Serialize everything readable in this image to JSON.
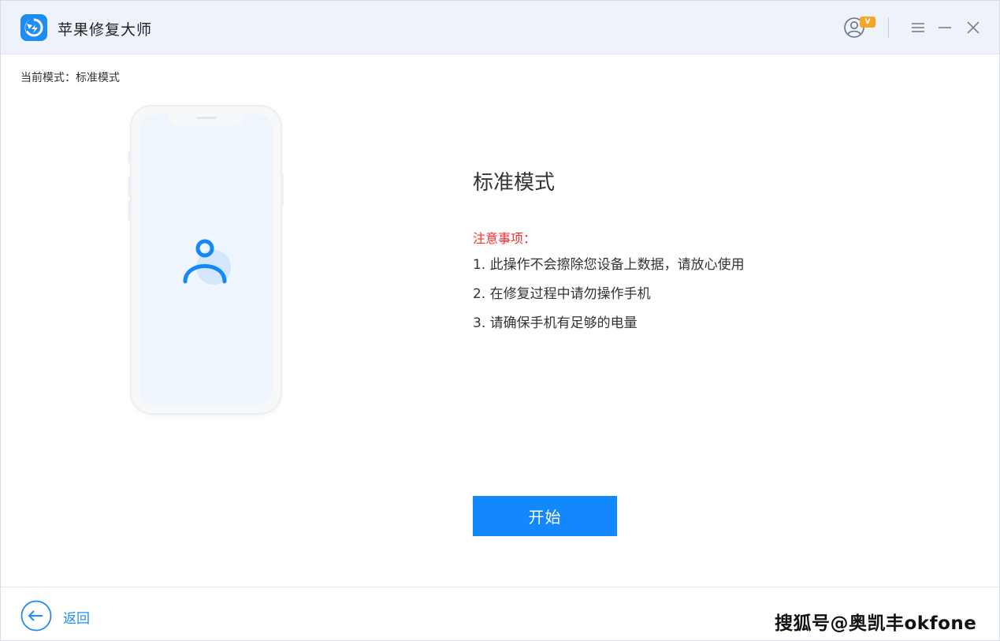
{
  "window": {
    "title": "苹果修复大师",
    "accent_color": "#1288fc",
    "vip_badge": "V"
  },
  "mode_line": {
    "label": "当前模式：标准模式"
  },
  "main": {
    "title": "标准模式",
    "notice_title": "注意事项：",
    "notices": [
      "1. 此操作不会擦除您设备上数据，请放心使用",
      "2. 在修复过程中请勿操作手机",
      "3. 请确保手机有足够的电量"
    ],
    "notice_color": "#ff2b2b",
    "start_label": "开始"
  },
  "footer": {
    "back_label": "返回",
    "watermark": "搜狐号@奥凯丰okfone"
  },
  "icons": {
    "logo": "app-logo-icon",
    "user": "user-account-icon",
    "menu": "hamburger-menu-icon",
    "minimize": "minimize-icon",
    "close": "close-icon",
    "back": "arrow-left-circle-icon",
    "phone_user": "user-icon"
  }
}
